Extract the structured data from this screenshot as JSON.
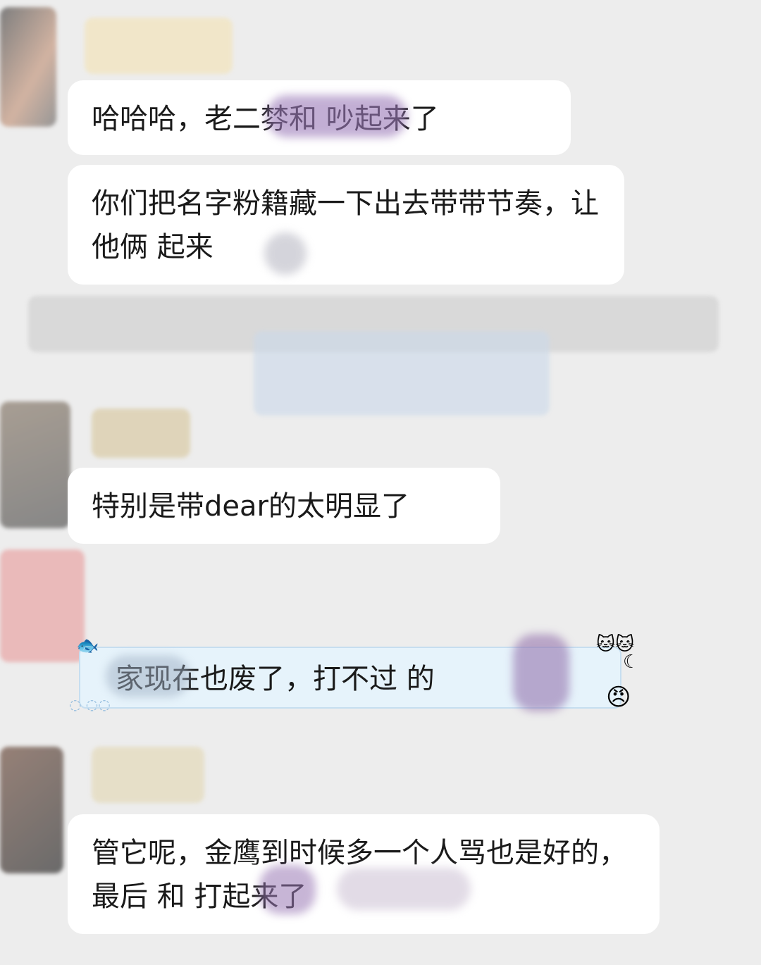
{
  "messages": [
    {
      "text": "哈哈哈，老二棼和 吵起来了"
    },
    {
      "text": "你们把名字粉籍藏一下出去带带节奏，让他俩 起来"
    },
    {
      "text": "特别是带dear的太明显了"
    },
    {
      "text": "  家现在也废了，打不过  的"
    },
    {
      "text": "管它呢，金鹰到时候多一个人骂也是好的，最后  和      打起来了"
    }
  ],
  "colors": {
    "background": "#ededed",
    "bubble": "#ffffff",
    "fancy_bubble": "#e6f3fb",
    "text": "#1a1a1a"
  },
  "icons": [
    "fish-sticker-icon",
    "cat-sticker-icon",
    "baby-face-sticker-icon",
    "moon-icon"
  ]
}
